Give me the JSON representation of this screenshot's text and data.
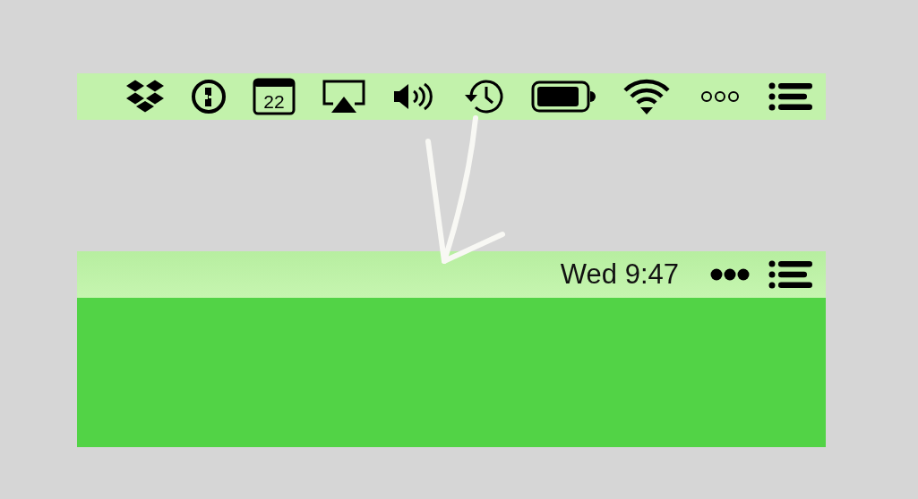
{
  "top_bar": {
    "calendar_day": "22",
    "expanded": true
  },
  "bottom_bar": {
    "clock": "Wed 9:47",
    "expanded": false
  }
}
